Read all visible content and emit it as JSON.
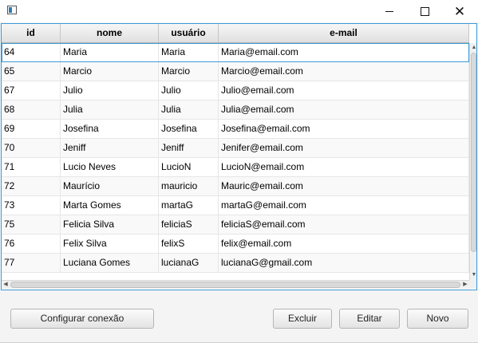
{
  "window": {
    "controls": {
      "minimize_icon": "minimize-icon",
      "maximize_icon": "maximize-icon",
      "close_icon": "close-icon"
    }
  },
  "table": {
    "columns": [
      "id",
      "nome",
      "usuário",
      "e-mail"
    ],
    "rows": [
      [
        "64",
        "Maria",
        "Maria",
        "Maria@email.com"
      ],
      [
        "65",
        "Marcio",
        "Marcio",
        "Marcio@email.com"
      ],
      [
        "67",
        "Julio",
        "Julio",
        "Julio@email.com"
      ],
      [
        "68",
        "Julia",
        "Julia",
        "Julia@email.com"
      ],
      [
        "69",
        "Josefina",
        "Josefina",
        "Josefina@email.com"
      ],
      [
        "70",
        "Jeniff",
        "Jeniff",
        "Jenifer@email.com"
      ],
      [
        "71",
        "Lucio Neves",
        "LucioN",
        "LucioN@email.com"
      ],
      [
        "72",
        "Maurício",
        "mauricio",
        "Mauric@email.com"
      ],
      [
        "73",
        "Marta Gomes",
        "martaG",
        "martaG@email.com"
      ],
      [
        "75",
        "Felicia Silva",
        "feliciaS",
        "feliciaS@email.com"
      ],
      [
        "76",
        "Felix Silva",
        "felixS",
        "felix@email.com"
      ],
      [
        "77",
        "Luciana Gomes",
        "lucianaG",
        "lucianaG@gmail.com"
      ]
    ],
    "selected_row": 0
  },
  "buttons": {
    "configure": "Configurar conexão",
    "delete": "Excluir",
    "edit": "Editar",
    "new": "Novo"
  },
  "colors": {
    "accent": "#3c9ad8"
  }
}
